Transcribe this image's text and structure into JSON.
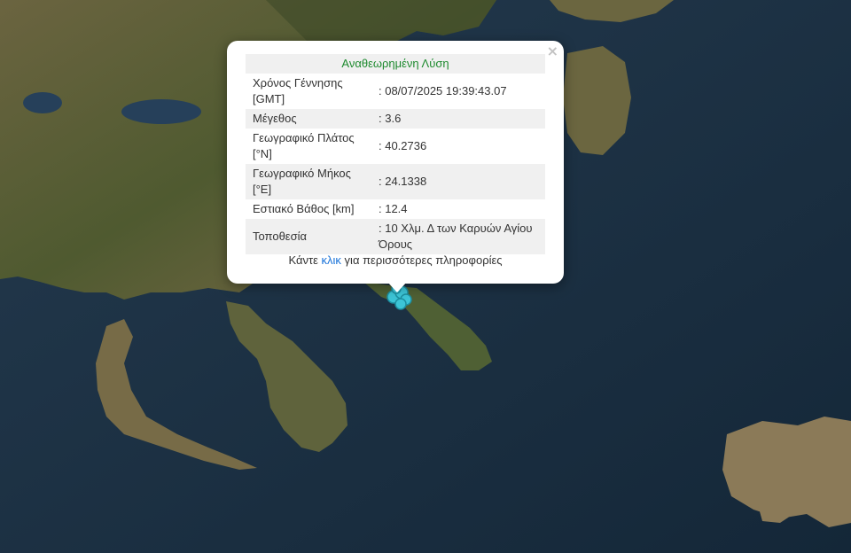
{
  "popup": {
    "title": "Αναθεωρημένη Λύση",
    "close_icon": "×",
    "rows": [
      {
        "label": "Χρόνος Γέννησης [GMT]",
        "value": ": 08/07/2025 19:39:43.07"
      },
      {
        "label": "Μέγεθος",
        "value": ": 3.6"
      },
      {
        "label": "Γεωγραφικό Πλάτος [°N]",
        "value": ": 40.2736"
      },
      {
        "label": "Γεωγραφικό Μήκος [°E]",
        "value": ": 24.1338"
      },
      {
        "label": "Εστιακό Βάθος [km]",
        "value": ": 12.4"
      },
      {
        "label": "Τοποθεσία",
        "value": ": 10 Χλμ. Δ των Καρυών Αγίου Όρους"
      }
    ],
    "more_before": "Κάντε ",
    "more_link": "κλικ",
    "more_after": " για περισσότερες πληροφορίες"
  },
  "colors": {
    "sea": "#1b3247",
    "land": "#5b5b36",
    "marker": "#3cc4d6",
    "title": "#1d8a2e",
    "link": "#1a73d9"
  }
}
